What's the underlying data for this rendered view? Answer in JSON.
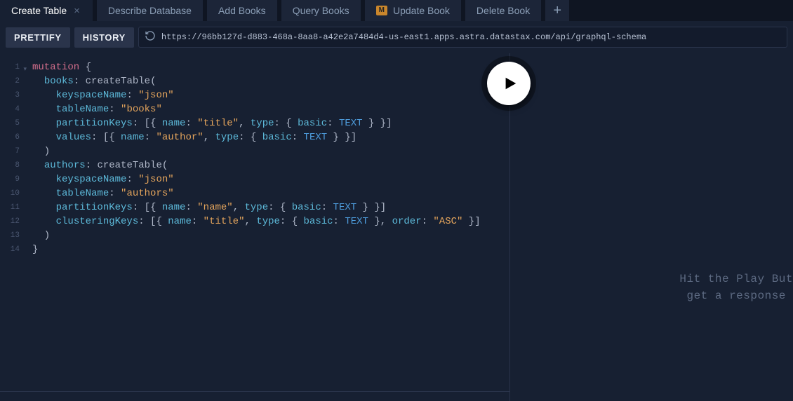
{
  "tabs": [
    {
      "label": "Create Table",
      "active": true
    },
    {
      "label": "Describe Database"
    },
    {
      "label": "Add Books"
    },
    {
      "label": "Query Books"
    },
    {
      "label": "Update Book",
      "modified": true,
      "badge": "M"
    },
    {
      "label": "Delete Book"
    }
  ],
  "toolbar": {
    "prettify": "PRETTIFY",
    "history": "HISTORY",
    "url": "https://96bb127d-d883-468a-8aa8-a42e2a7484d4-us-east1.apps.astra.datastax.com/api/graphql-schema"
  },
  "editor": {
    "lineCount": 14,
    "tokens": [
      [
        {
          "t": "kw",
          "v": "mutation"
        },
        {
          "t": "punc",
          "v": " {"
        }
      ],
      [
        {
          "t": "sp",
          "v": "  "
        },
        {
          "t": "prop",
          "v": "books"
        },
        {
          "t": "punc",
          "v": ": "
        },
        {
          "t": "fn",
          "v": "createTable"
        },
        {
          "t": "punc",
          "v": "("
        }
      ],
      [
        {
          "t": "sp",
          "v": "    "
        },
        {
          "t": "prop",
          "v": "keyspaceName"
        },
        {
          "t": "punc",
          "v": ": "
        },
        {
          "t": "str",
          "v": "\"json\""
        }
      ],
      [
        {
          "t": "sp",
          "v": "    "
        },
        {
          "t": "prop",
          "v": "tableName"
        },
        {
          "t": "punc",
          "v": ": "
        },
        {
          "t": "str",
          "v": "\"books\""
        }
      ],
      [
        {
          "t": "sp",
          "v": "    "
        },
        {
          "t": "prop",
          "v": "partitionKeys"
        },
        {
          "t": "punc",
          "v": ": [{ "
        },
        {
          "t": "prop",
          "v": "name"
        },
        {
          "t": "punc",
          "v": ": "
        },
        {
          "t": "str",
          "v": "\"title\""
        },
        {
          "t": "punc",
          "v": ", "
        },
        {
          "t": "prop",
          "v": "type"
        },
        {
          "t": "punc",
          "v": ": { "
        },
        {
          "t": "prop",
          "v": "basic"
        },
        {
          "t": "punc",
          "v": ": "
        },
        {
          "t": "enum",
          "v": "TEXT"
        },
        {
          "t": "punc",
          "v": " } }]"
        }
      ],
      [
        {
          "t": "sp",
          "v": "    "
        },
        {
          "t": "prop",
          "v": "values"
        },
        {
          "t": "punc",
          "v": ": [{ "
        },
        {
          "t": "prop",
          "v": "name"
        },
        {
          "t": "punc",
          "v": ": "
        },
        {
          "t": "str",
          "v": "\"author\""
        },
        {
          "t": "punc",
          "v": ", "
        },
        {
          "t": "prop",
          "v": "type"
        },
        {
          "t": "punc",
          "v": ": { "
        },
        {
          "t": "prop",
          "v": "basic"
        },
        {
          "t": "punc",
          "v": ": "
        },
        {
          "t": "enum",
          "v": "TEXT"
        },
        {
          "t": "punc",
          "v": " } }]"
        }
      ],
      [
        {
          "t": "punc",
          "v": "  )"
        }
      ],
      [
        {
          "t": "sp",
          "v": "  "
        },
        {
          "t": "prop",
          "v": "authors"
        },
        {
          "t": "punc",
          "v": ": "
        },
        {
          "t": "fn",
          "v": "createTable"
        },
        {
          "t": "punc",
          "v": "("
        }
      ],
      [
        {
          "t": "sp",
          "v": "    "
        },
        {
          "t": "prop",
          "v": "keyspaceName"
        },
        {
          "t": "punc",
          "v": ": "
        },
        {
          "t": "str",
          "v": "\"json\""
        }
      ],
      [
        {
          "t": "sp",
          "v": "    "
        },
        {
          "t": "prop",
          "v": "tableName"
        },
        {
          "t": "punc",
          "v": ": "
        },
        {
          "t": "str",
          "v": "\"authors\""
        }
      ],
      [
        {
          "t": "sp",
          "v": "    "
        },
        {
          "t": "prop",
          "v": "partitionKeys"
        },
        {
          "t": "punc",
          "v": ": [{ "
        },
        {
          "t": "prop",
          "v": "name"
        },
        {
          "t": "punc",
          "v": ": "
        },
        {
          "t": "str",
          "v": "\"name\""
        },
        {
          "t": "punc",
          "v": ", "
        },
        {
          "t": "prop",
          "v": "type"
        },
        {
          "t": "punc",
          "v": ": { "
        },
        {
          "t": "prop",
          "v": "basic"
        },
        {
          "t": "punc",
          "v": ": "
        },
        {
          "t": "enum",
          "v": "TEXT"
        },
        {
          "t": "punc",
          "v": " } }]"
        }
      ],
      [
        {
          "t": "sp",
          "v": "    "
        },
        {
          "t": "prop",
          "v": "clusteringKeys"
        },
        {
          "t": "punc",
          "v": ": [{ "
        },
        {
          "t": "prop",
          "v": "name"
        },
        {
          "t": "punc",
          "v": ": "
        },
        {
          "t": "str",
          "v": "\"title\""
        },
        {
          "t": "punc",
          "v": ", "
        },
        {
          "t": "prop",
          "v": "type"
        },
        {
          "t": "punc",
          "v": ": { "
        },
        {
          "t": "prop",
          "v": "basic"
        },
        {
          "t": "punc",
          "v": ": "
        },
        {
          "t": "enum",
          "v": "TEXT"
        },
        {
          "t": "punc",
          "v": " }, "
        },
        {
          "t": "prop",
          "v": "order"
        },
        {
          "t": "punc",
          "v": ": "
        },
        {
          "t": "str",
          "v": "\"ASC\""
        },
        {
          "t": "punc",
          "v": " }]"
        }
      ],
      [
        {
          "t": "punc",
          "v": "  )"
        }
      ],
      [
        {
          "t": "punc",
          "v": "}"
        }
      ]
    ]
  },
  "results": {
    "hintLine1": "Hit the Play But",
    "hintLine2": "get a response"
  }
}
